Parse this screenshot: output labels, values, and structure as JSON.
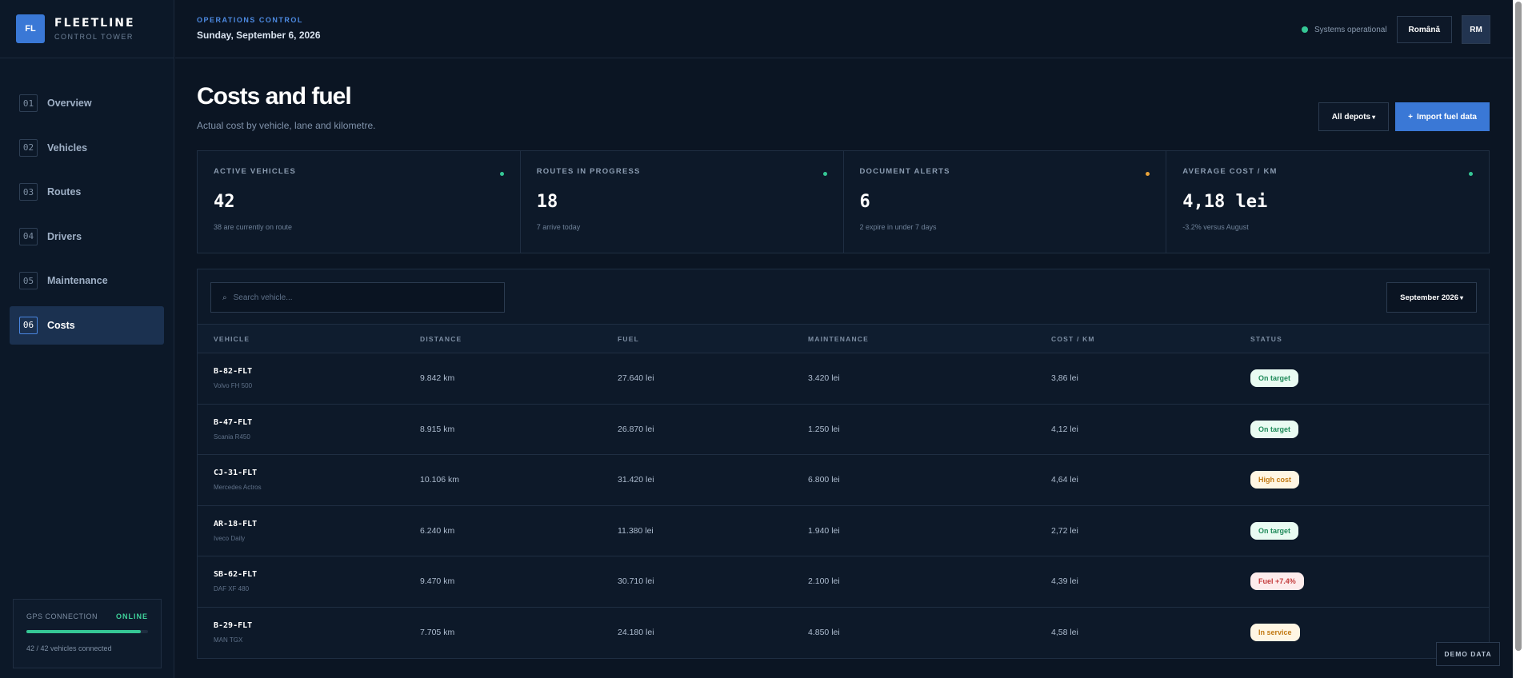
{
  "brand": {
    "logo": "FL",
    "name": "FLEETLINE",
    "subtitle": "CONTROL TOWER"
  },
  "nav": [
    {
      "num": "01",
      "label": "Overview",
      "active": false
    },
    {
      "num": "02",
      "label": "Vehicles",
      "active": false
    },
    {
      "num": "03",
      "label": "Routes",
      "active": false
    },
    {
      "num": "04",
      "label": "Drivers",
      "active": false
    },
    {
      "num": "05",
      "label": "Maintenance",
      "active": false
    },
    {
      "num": "06",
      "label": "Costs",
      "active": true
    }
  ],
  "gps": {
    "label": "GPS CONNECTION",
    "status": "ONLINE",
    "progress": 0.94,
    "note": "42 / 42 vehicles connected"
  },
  "header": {
    "kicker": "OPERATIONS CONTROL",
    "date": "Sunday, September 6, 2026",
    "status_text": "Systems operational",
    "language": "Română",
    "avatar": "RM"
  },
  "page": {
    "title": "Costs and fuel",
    "subtitle": "Actual cost by vehicle, lane and kilometre.",
    "depots_button": "All depots",
    "import_button": "Import fuel data",
    "import_plus": "+"
  },
  "kpis": [
    {
      "label": "ACTIVE VEHICLES",
      "value": "42",
      "note": "38 are currently on route",
      "dot_color": "#35c795"
    },
    {
      "label": "ROUTES IN PROGRESS",
      "value": "18",
      "note": "7 arrive today",
      "dot_color": "#35c795"
    },
    {
      "label": "DOCUMENT ALERTS",
      "value": "6",
      "note": "2 expire in under 7 days",
      "dot_color": "#e8a23a"
    },
    {
      "label": "AVERAGE COST / KM",
      "value": "4,18 lei",
      "note": "-3.2% versus August",
      "dot_color": "#35c795"
    }
  ],
  "table": {
    "search_placeholder": "Search vehicle...",
    "month": "September 2026",
    "columns": [
      "VEHICLE",
      "DISTANCE",
      "FUEL",
      "MAINTENANCE",
      "COST / KM",
      "STATUS"
    ],
    "rows": [
      {
        "id": "B-82-FLT",
        "model": "Volvo FH 500",
        "distance": "9.842 km",
        "fuel": "27.640 lei",
        "maintenance": "3.420 lei",
        "cost_km": "3,86 lei",
        "status": "On target",
        "status_color": "#1f8a5a",
        "status_bg": "#e9fbf2"
      },
      {
        "id": "B-47-FLT",
        "model": "Scania R450",
        "distance": "8.915 km",
        "fuel": "26.870 lei",
        "maintenance": "1.250 lei",
        "cost_km": "4,12 lei",
        "status": "On target",
        "status_color": "#1f8a5a",
        "status_bg": "#e9fbf2"
      },
      {
        "id": "CJ-31-FLT",
        "model": "Mercedes Actros",
        "distance": "10.106 km",
        "fuel": "31.420 lei",
        "maintenance": "6.800 lei",
        "cost_km": "4,64 lei",
        "status": "High cost",
        "status_color": "#c27a14",
        "status_bg": "#fff6e3"
      },
      {
        "id": "AR-18-FLT",
        "model": "Iveco Daily",
        "distance": "6.240 km",
        "fuel": "11.380 lei",
        "maintenance": "1.940 lei",
        "cost_km": "2,72 lei",
        "status": "On target",
        "status_color": "#1f8a5a",
        "status_bg": "#e9fbf2"
      },
      {
        "id": "SB-62-FLT",
        "model": "DAF XF 480",
        "distance": "9.470 km",
        "fuel": "30.710 lei",
        "maintenance": "2.100 lei",
        "cost_km": "4,39 lei",
        "status": "Fuel +7.4%",
        "status_color": "#c43c3c",
        "status_bg": "#fdecec"
      },
      {
        "id": "B-29-FLT",
        "model": "MAN TGX",
        "distance": "7.705 km",
        "fuel": "24.180 lei",
        "maintenance": "4.850 lei",
        "cost_km": "4,58 lei",
        "status": "In service",
        "status_color": "#c27a14",
        "status_bg": "#fff6e3"
      }
    ]
  },
  "demo_label": "DEMO DATA"
}
